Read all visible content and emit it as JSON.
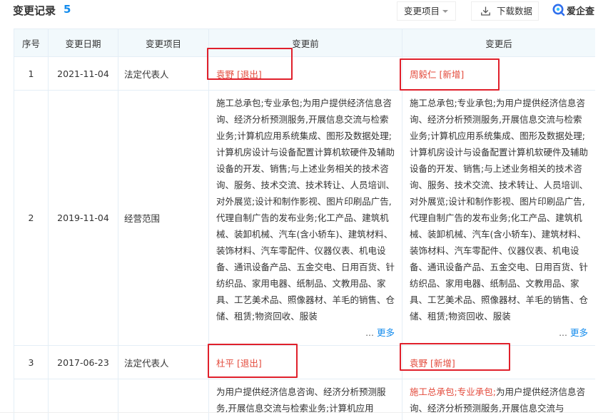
{
  "header": {
    "title": "变更记录",
    "count": "5",
    "filter_label": "变更项目",
    "download_label": "下载数据",
    "brand_text": "爱企查"
  },
  "table": {
    "columns": [
      "序号",
      "变更日期",
      "变更项目",
      "变更前",
      "变更后"
    ],
    "rows": [
      {
        "index": "1",
        "date": "2021-11-04",
        "item": "法定代表人",
        "before": "袁野 [退出]",
        "after": "周毅仁 [新增]"
      },
      {
        "index": "2",
        "date": "2019-11-04",
        "item": "经营范围",
        "before": "施工总承包;专业承包;为用户提供经济信息咨询、经济分析预测服务,开展信息交流与检索业务;计算机应用系统集成、图形及数据处理;计算机房设计与设备配置计算机软硬件及辅助设备的开发、销售;与上述业务相关的技术咨询、服务、技术交流、技术转让、人员培训、对外展览;设计和制作影视、图片印刷品广告,代理自制广告的发布业务;化工产品、建筑机械、装卸机械、汽车(含小轿车)、建筑材料、装饰材料、汽车零配件、仪器仪表、机电设备、通讯设备产品、五金交电、日用百货、针纺织品、家用电器、纸制品、文教用品、家具、工艺美术品、照像器材、羊毛的销售、仓储、租赁;物资回收、服装",
        "after": "施工总承包;专业承包;为用户提供经济信息咨询、经济分析预测服务,开展信息交流与检索业务;计算机应用系统集成、图形及数据处理;计算机房设计与设备配置计算机软硬件及辅助设备的开发、销售;与上述业务相关的技术咨询、服务、技术交流、技术转让、人员培训、对外展览;设计和制作影视、图片印刷品广告,代理自制广告的发布业务;化工产品、建筑机械、装卸机械、汽车(含小轿车)、建筑材料、装饰材料、汽车零配件、仪器仪表、机电设备、通讯设备产品、五金交电、日用百货、针纺织品、家用电器、纸制品、文教用品、家具、工艺美术品、照像器材、羊毛的销售、仓储、租赁;物资回收、服装",
        "ellipsis": "...",
        "more_label": "更多"
      },
      {
        "index": "3",
        "date": "2017-06-23",
        "item": "法定代表人",
        "before": "杜平 [退出]",
        "after": "袁野 [新增]"
      },
      {
        "index": "",
        "date": "",
        "item": "",
        "before": "为用户提供经济信息咨询、经济分析预测服务,开展信息交流与检索业务;计算机应用",
        "after_highlight": "施工总承包;专业承包;",
        "after_rest": "为用户提供经济信息咨询、经济分析预测服务,开展信息交流与"
      }
    ]
  },
  "colors": {
    "accent_blue": "#128bed",
    "change_red": "#e34a3b",
    "annotation_red": "#e0202b",
    "header_bg": "#f2f9fc"
  },
  "icons": {
    "filter_caret": "chevron-down-icon",
    "download": "download-icon",
    "brand": "brand-logo-icon"
  }
}
